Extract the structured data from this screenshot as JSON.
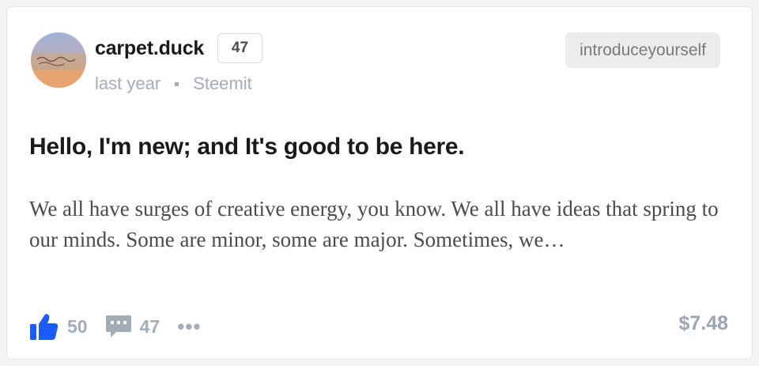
{
  "post": {
    "author": "carpet.duck",
    "reputation": "47",
    "time": "last year",
    "app": "Steemit",
    "tag": "introduceyourself",
    "title": "Hello, I'm new; and It's good to be here.",
    "excerpt": "We all have surges of creative energy, you know. We all have ideas that spring to our minds. Some are minor, some are major. Sometimes, we…",
    "upvotes": "50",
    "comments": "47",
    "more_label": "•••",
    "payout": "$7.48"
  },
  "icons": {
    "avatar": "avatar-image",
    "upvote": "thumbs-up-icon",
    "comment": "comment-bubble-icon",
    "more": "ellipsis-icon"
  },
  "colors": {
    "accent": "#1a5cff",
    "muted": "#a3adb8"
  }
}
